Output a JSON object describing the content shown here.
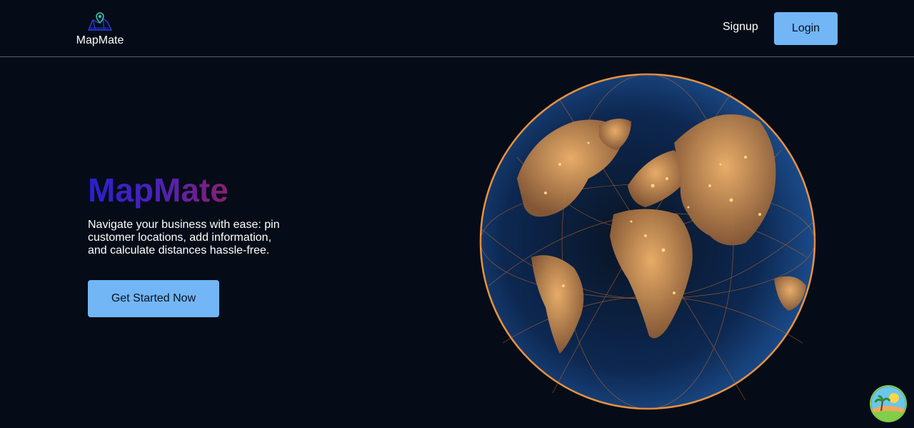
{
  "header": {
    "brand": "MapMate",
    "signup_label": "Signup",
    "login_label": "Login"
  },
  "hero": {
    "title": "MapMate",
    "description": "Navigate your business with ease: pin customer locations, add information, and calculate distances hassle-free.",
    "cta_label": "Get Started Now"
  },
  "icons": {
    "logo": "map-pin-logo-icon",
    "globe": "earth-globe-image",
    "fab": "island-avatar-icon"
  },
  "colors": {
    "background": "#050c17",
    "accent_button": "#72b6f6",
    "title_gradient_start": "#2a1fd0",
    "title_gradient_end": "#8a1f6f",
    "globe_glow": "#f5a045"
  }
}
